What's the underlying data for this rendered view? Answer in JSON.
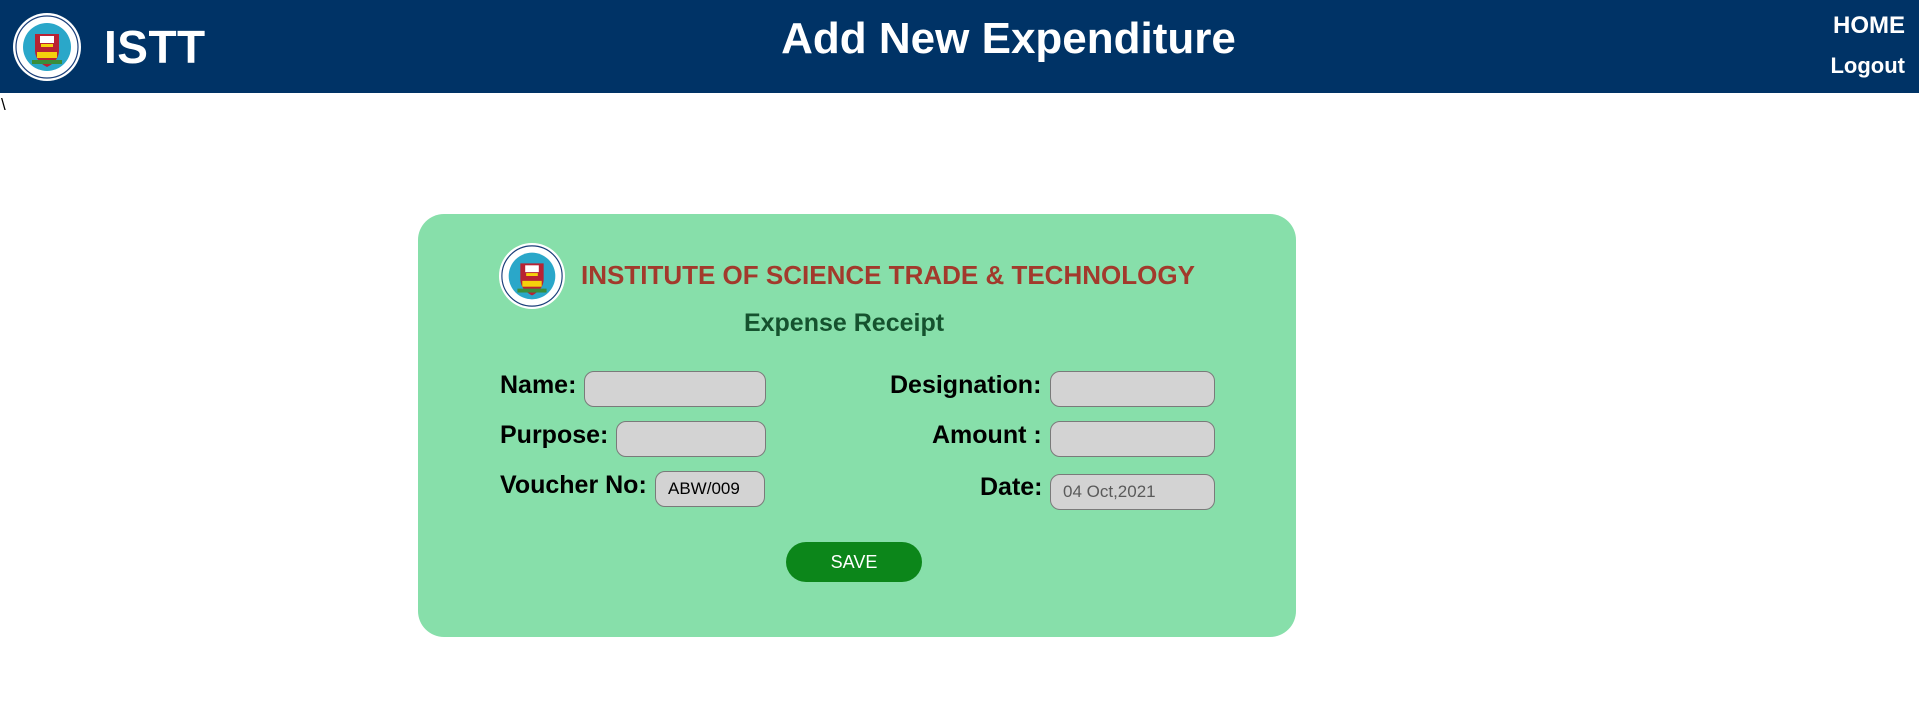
{
  "header": {
    "brand_name": "ISTT",
    "page_title": "Add New Expenditure",
    "nav": {
      "home": "HOME",
      "logout": "Logout"
    },
    "background_color": "#003366"
  },
  "stray_text": "\\",
  "card": {
    "background_color": "#87dfaa",
    "institute_name": "INSTITUTE OF SCIENCE TRADE & TECHNOLOGY",
    "receipt_title": "Expense Receipt",
    "fields": {
      "name": {
        "label": "Name:",
        "value": ""
      },
      "purpose": {
        "label": "Purpose:",
        "value": ""
      },
      "voucher_no": {
        "label": "Voucher No:",
        "value": "ABW/009"
      },
      "designation": {
        "label": "Designation:",
        "value": ""
      },
      "amount": {
        "label": "Amount :",
        "value": ""
      },
      "date": {
        "label": "Date:",
        "value": "",
        "placeholder": "04 Oct,2021"
      }
    },
    "save_label": "SAVE"
  },
  "icons": {
    "logo": "istt-crest-logo"
  }
}
